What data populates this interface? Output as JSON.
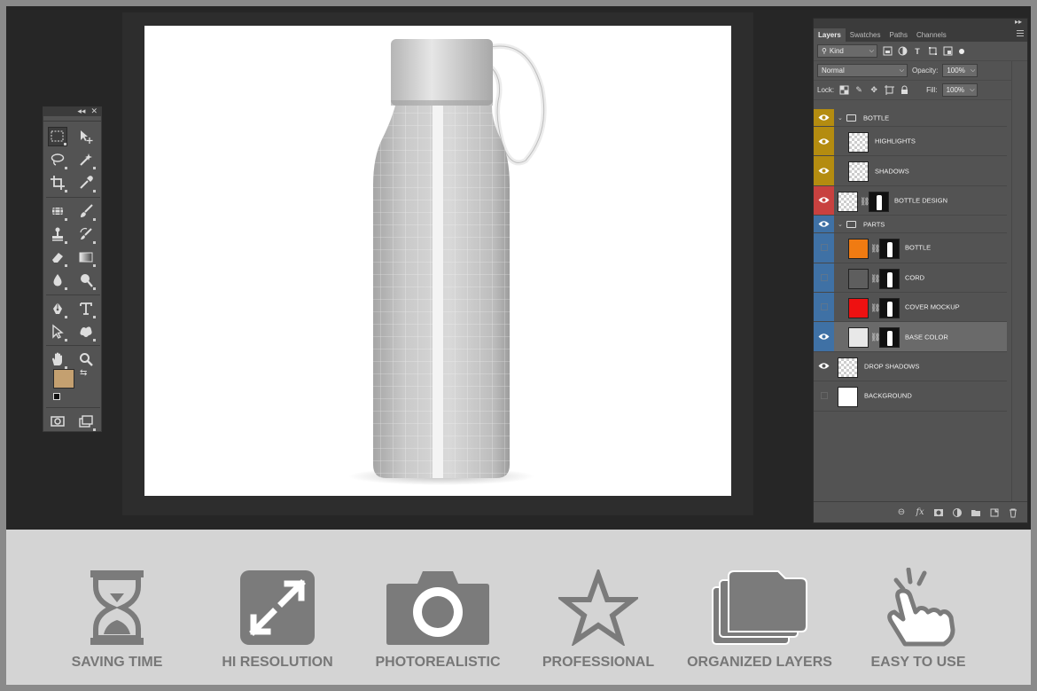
{
  "layers_panel": {
    "tabs": [
      "Layers",
      "Swatches",
      "Paths",
      "Channels"
    ],
    "filter_kind": "Kind",
    "blend_mode": "Normal",
    "opacity_label": "Opacity:",
    "opacity_value": "100%",
    "lock_label": "Lock:",
    "fill_label": "Fill:",
    "fill_value": "100%",
    "layers": [
      {
        "name": "BOTTLE",
        "type": "group",
        "color": "#b48c10",
        "visible": true
      },
      {
        "name": "HIGHLIGHTS",
        "type": "layer",
        "color": "#b48c10",
        "visible": true
      },
      {
        "name": "SHADOWS",
        "type": "layer",
        "color": "#b48c10",
        "visible": true
      },
      {
        "name": "BOTTLE DESIGN",
        "type": "smart-mask",
        "color": "#c8413f",
        "visible": true
      },
      {
        "name": "PARTS",
        "type": "group",
        "color": "#3f71a5",
        "visible": true
      },
      {
        "name": "BOTTLE",
        "type": "fill-mask",
        "color": "#3f71a5",
        "visible": false,
        "swatch": "#f07b12"
      },
      {
        "name": "CORD",
        "type": "fill-mask",
        "color": "#3f71a5",
        "visible": false,
        "swatch": "#5e5e5e"
      },
      {
        "name": "COVER MOCKUP",
        "type": "fill-mask",
        "color": "#3f71a5",
        "visible": false,
        "swatch": "#ee1111"
      },
      {
        "name": "BASE COLOR",
        "type": "fill-mask",
        "color": "#3f71a5",
        "visible": true,
        "swatch": "#e8e8e8",
        "selected": true
      },
      {
        "name": "DROP SHADOWS",
        "type": "layer",
        "color": "",
        "visible": true
      },
      {
        "name": "BACKGROUND",
        "type": "fill",
        "color": "",
        "visible": false,
        "swatch": "#ffffff"
      }
    ]
  },
  "tools": {
    "foreground_color": "#c4a070",
    "background_color": "#222222"
  },
  "features": [
    {
      "label": "SAVING TIME",
      "icon": "hourglass-icon"
    },
    {
      "label": "HI RESOLUTION",
      "icon": "expand-arrows-icon"
    },
    {
      "label": "PHOTOREALISTIC",
      "icon": "camera-icon"
    },
    {
      "label": "PROFESSIONAL",
      "icon": "star-icon"
    },
    {
      "label": "ORGANIZED LAYERS",
      "icon": "folder-stack-icon"
    },
    {
      "label": "EASY TO USE",
      "icon": "tap-hand-icon"
    }
  ]
}
